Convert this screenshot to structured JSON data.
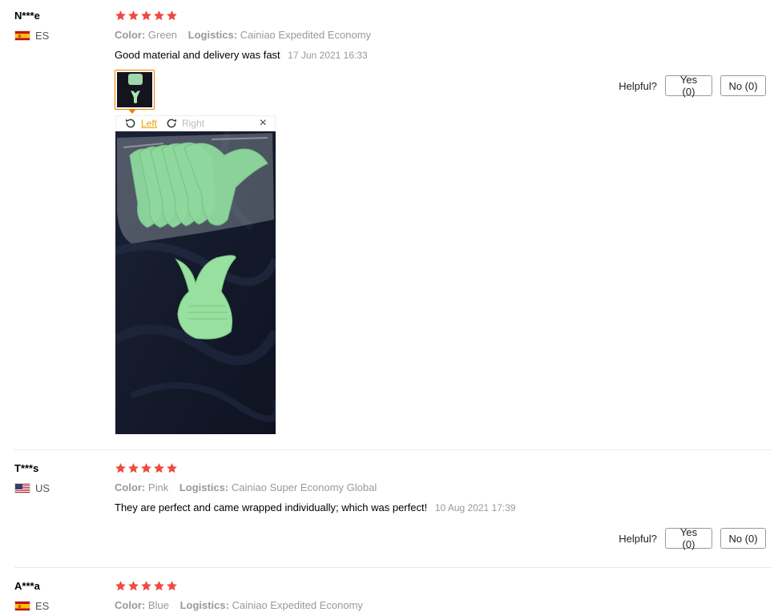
{
  "reviews": [
    {
      "user": "N***e",
      "country": "ES",
      "stars": 5,
      "color_label": "Color:",
      "color_value": "Green",
      "logistics_label": "Logistics:",
      "logistics_value": "Cainiao Expedited Economy",
      "text": "Good material and delivery was fast",
      "date": "17 Jun 2021 16:33",
      "helpful_label": "Helpful?",
      "yes": "Yes (0)",
      "no": "No (0)",
      "viewer": {
        "left": "Left",
        "right": "Right",
        "close": "×"
      }
    },
    {
      "user": "T***s",
      "country": "US",
      "stars": 5,
      "color_label": "Color:",
      "color_value": "Pink",
      "logistics_label": "Logistics:",
      "logistics_value": "Cainiao Super Economy Global",
      "text": "They are perfect and came wrapped individually; which was perfect!",
      "date": "10 Aug 2021 17:39",
      "helpful_label": "Helpful?",
      "yes": "Yes (0)",
      "no": "No (0)"
    },
    {
      "user": "A***a",
      "country": "ES",
      "stars": 5,
      "color_label": "Color:",
      "color_value": "Blue",
      "logistics_label": "Logistics:",
      "logistics_value": "Cainiao Expedited Economy"
    }
  ],
  "colors": {
    "star": "#f04a3f",
    "accent": "#f07c00",
    "rotate_active": "#e5a000",
    "divider": "#e8e8e8"
  },
  "icons": [
    "star-icon",
    "flag-es-icon",
    "flag-us-icon",
    "rotate-left-icon",
    "rotate-right-icon",
    "close-icon"
  ]
}
